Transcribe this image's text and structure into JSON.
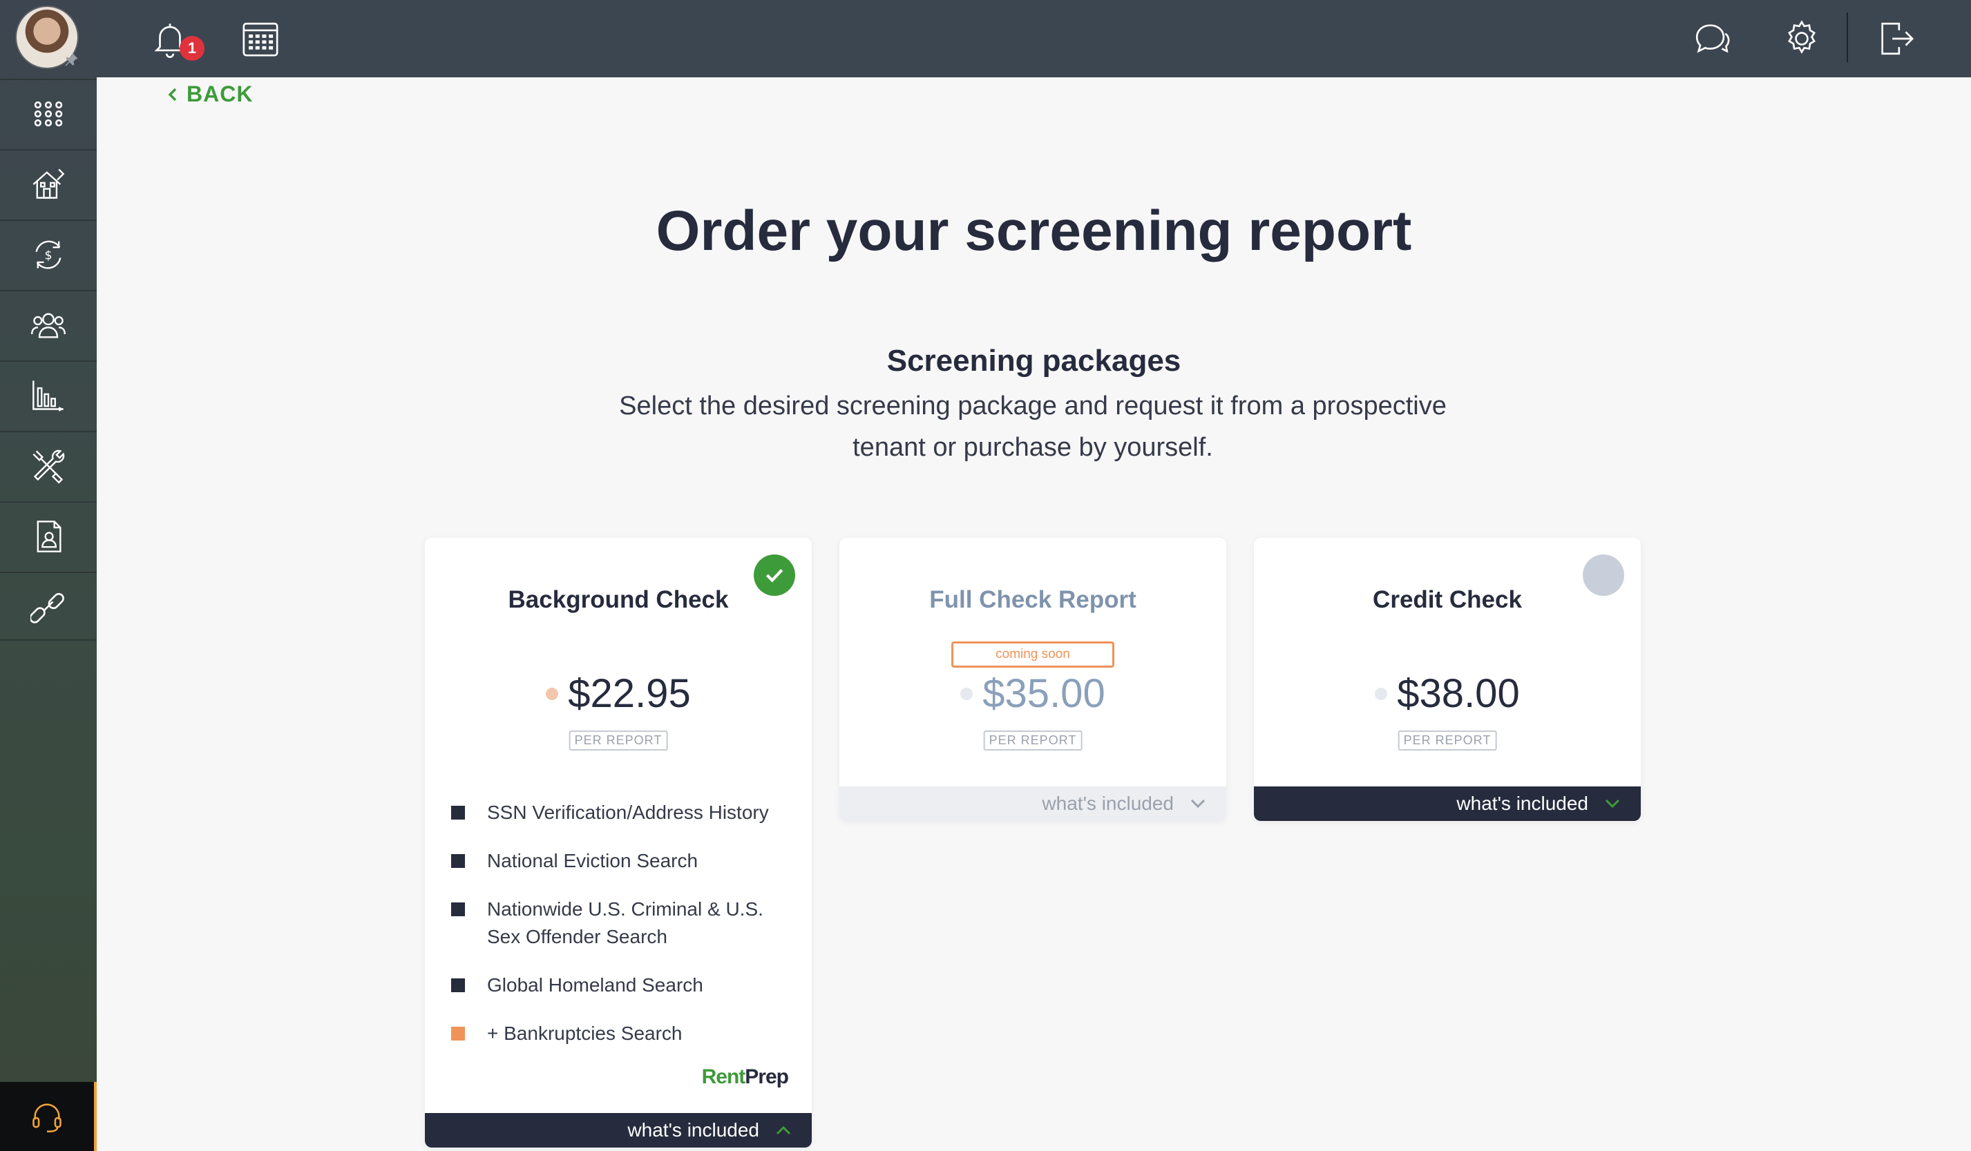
{
  "nav": {
    "items": [
      "apps-grid-icon",
      "property-icon",
      "payments-icon",
      "tenants-icon",
      "reports-icon",
      "maintenance-icon",
      "screening-icon",
      "link-icon"
    ]
  },
  "topbar": {
    "notifications_count": "1",
    "icons": [
      "bell-icon",
      "calendar-icon",
      "chat-icon",
      "gear-icon",
      "logout-icon"
    ]
  },
  "back_label": "BACK",
  "page_title": "Order your screening report",
  "section": {
    "title": "Screening packages",
    "description": "Select the desired screening package and request it from a prospective tenant or purchase by yourself."
  },
  "cards": [
    {
      "title": "Background Check",
      "price": "$22.95",
      "per_label": "PER REPORT",
      "selected": true,
      "features": [
        "SSN Verification/Address History",
        "National Eviction Search",
        "Nationwide U.S. Criminal & U.S. Sex Offender Search",
        "Global Homeland Search",
        "+ Bankruptcies Search"
      ],
      "brand_rent": "Rent",
      "brand_prep": "Prep",
      "included_label": "what's included"
    },
    {
      "title": "Full Check Report",
      "badge": "coming soon",
      "price": "$35.00",
      "per_label": "PER REPORT",
      "included_label": "what's included"
    },
    {
      "title": "Credit Check",
      "price": "$38.00",
      "per_label": "PER REPORT",
      "selected": false,
      "included_label": "what's included"
    }
  ],
  "colors": {
    "accent_green": "#3e9b3a",
    "dark_navy": "#262b3d",
    "orange": "#f09358",
    "topbar": "#3c4651"
  }
}
